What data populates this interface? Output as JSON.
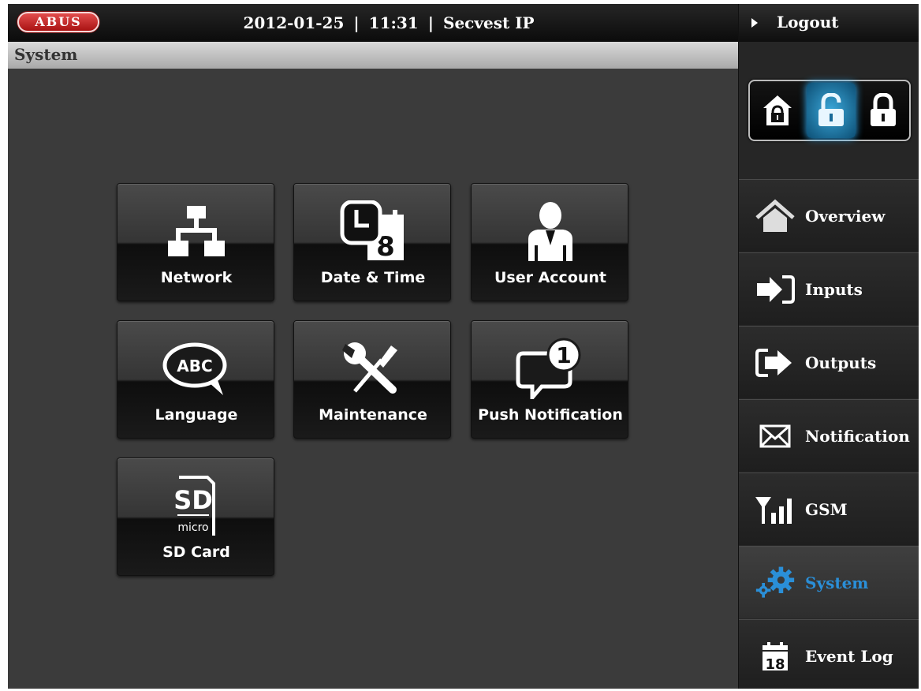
{
  "header": {
    "logo_text": "ABUS",
    "date": "2012-01-25",
    "separator": "|",
    "time": "11:31",
    "device": "Secvest IP"
  },
  "page": {
    "title": "System"
  },
  "tiles": [
    {
      "label": "Network",
      "icon": "network-icon"
    },
    {
      "label": "Date & Time",
      "icon": "calendar-clock-icon",
      "icon_text": "8"
    },
    {
      "label": "User Account",
      "icon": "user-icon"
    },
    {
      "label": "Language",
      "icon": "speech-bubble-icon",
      "icon_text": "ABC"
    },
    {
      "label": "Maintenance",
      "icon": "tools-icon"
    },
    {
      "label": "Push Notification",
      "icon": "notification-bubble-icon",
      "badge": "1"
    },
    {
      "label": "SD Card",
      "icon": "sd-card-icon",
      "icon_text": "SD",
      "icon_subtext": "micro"
    }
  ],
  "sidebar": {
    "logout": "Logout",
    "lock_states": [
      "home-lock-icon",
      "unlocked-icon",
      "locked-icon"
    ],
    "active_lock_state": "unlocked-icon",
    "items": [
      {
        "label": "Overview",
        "icon": "home-icon"
      },
      {
        "label": "Inputs",
        "icon": "input-arrow-icon"
      },
      {
        "label": "Outputs",
        "icon": "output-arrow-icon"
      },
      {
        "label": "Notification",
        "icon": "envelope-icon"
      },
      {
        "label": "GSM",
        "icon": "signal-bars-icon"
      },
      {
        "label": "System",
        "icon": "gears-icon",
        "active": true
      },
      {
        "label": "Event Log",
        "icon": "calendar-icon",
        "icon_text": "18"
      }
    ],
    "accent_color": "#2a8fd8"
  }
}
